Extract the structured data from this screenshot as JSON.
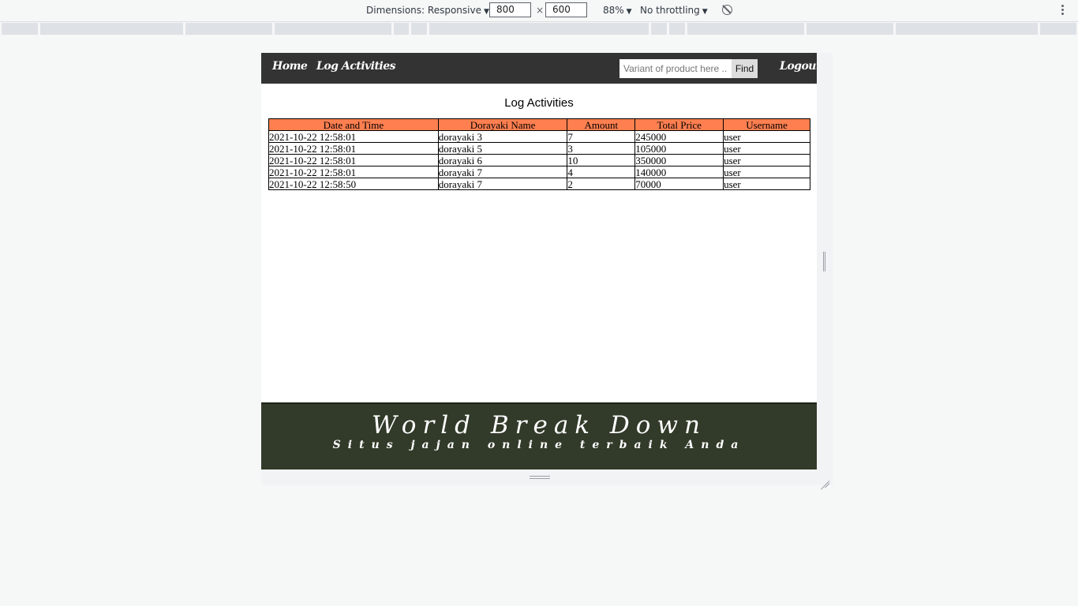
{
  "devtools": {
    "dimensions_label": "Dimensions: Responsive",
    "width_value": "800",
    "times": "×",
    "height_value": "600",
    "zoom": "88%",
    "throttling": "No throttling",
    "caret": "▼",
    "rotate_icon": "rotate-icon",
    "menu_icon": "kebab-menu-icon"
  },
  "nav": {
    "home": "Home",
    "log_activities": "Log Activities",
    "search_placeholder": "Variant of product here ...",
    "find": "Find",
    "logout": "Logout"
  },
  "page": {
    "title": "Log Activities"
  },
  "table": {
    "headers": [
      "Date and Time",
      "Dorayaki Name",
      "Amount",
      "Total Price",
      "Username"
    ],
    "rows": [
      [
        "2021-10-22 12:58:01",
        "dorayaki 3",
        "7",
        "245000",
        "user"
      ],
      [
        "2021-10-22 12:58:01",
        "dorayaki 5",
        "3",
        "105000",
        "user"
      ],
      [
        "2021-10-22 12:58:01",
        "dorayaki 6",
        "10",
        "350000",
        "user"
      ],
      [
        "2021-10-22 12:58:01",
        "dorayaki 7",
        "4",
        "140000",
        "user"
      ],
      [
        "2021-10-22 12:58:50",
        "dorayaki 7",
        "2",
        "70000",
        "user"
      ]
    ]
  },
  "footer": {
    "title": "World Break Down",
    "subtitle": "Situs jajan online terbaik Anda"
  },
  "colors": {
    "navbar": "#333333",
    "table_header": "#ff7f50",
    "footer": "#323a29"
  }
}
